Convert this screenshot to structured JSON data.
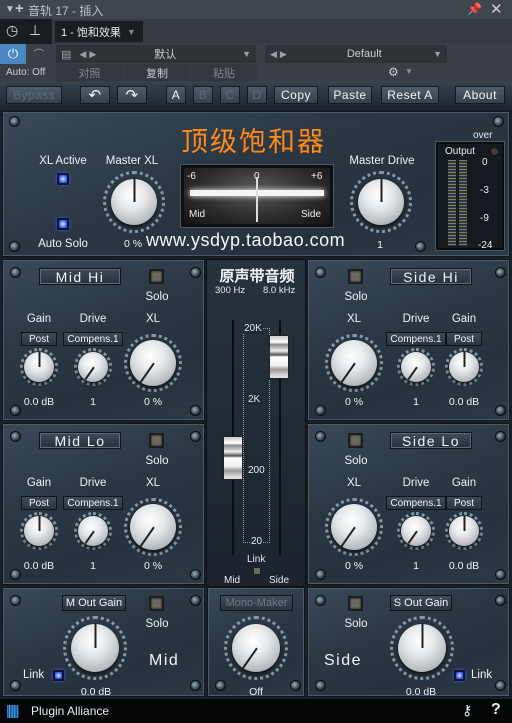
{
  "host": {
    "title": "音轨 17 - 插入",
    "preset_slot": "1 - 饱和效果",
    "auto_label": "Auto: Off",
    "preset_name_left": "默认",
    "preset_name_right": "Default",
    "compare_label": "对照",
    "copy_label": "复制",
    "paste_label": "粘贴"
  },
  "toolbar": {
    "bypass": "Bypass",
    "undo_icon": "undo-icon",
    "redo_icon": "redo-icon",
    "slots": [
      "A",
      "B",
      "C",
      "D"
    ],
    "copy": "Copy",
    "paste": "Paste",
    "reset": "Reset A",
    "about": "About"
  },
  "master": {
    "title": "顶级饱和器",
    "xl_active_label": "XL Active",
    "auto_solo_label": "Auto Solo",
    "master_xl_label": "Master XL",
    "master_xl_value": "0 %",
    "master_drive_label": "Master Drive",
    "master_drive_value": "1",
    "watermark": "www.ysdyp.taobao.com",
    "meter": {
      "left": "-6",
      "center": "0",
      "right": "+6",
      "mid": "Mid",
      "side": "Side"
    },
    "output": {
      "over": "over",
      "label": "Output",
      "scale": [
        "0",
        "-3",
        "-9",
        "-24"
      ]
    }
  },
  "bands": {
    "mid_hi": {
      "title": "Mid Hi",
      "solo": "Solo",
      "gain": "Gain",
      "drive": "Drive",
      "xl": "XL",
      "gain_mode": "Post",
      "drive_mode": "Compens.1",
      "gain_value": "0.0 dB",
      "drive_value": "1",
      "xl_value": "0 %"
    },
    "mid_lo": {
      "title": "Mid Lo",
      "solo": "Solo",
      "gain": "Gain",
      "drive": "Drive",
      "xl": "XL",
      "gain_mode": "Post",
      "drive_mode": "Compens.1",
      "gain_value": "0.0 dB",
      "drive_value": "1",
      "xl_value": "0 %"
    },
    "side_hi": {
      "title": "Side Hi",
      "solo": "Solo",
      "gain": "Gain",
      "drive": "Drive",
      "xl": "XL",
      "gain_mode": "Post",
      "drive_mode": "Compens.1",
      "gain_value": "0.0 dB",
      "drive_value": "1",
      "xl_value": "0 %"
    },
    "side_lo": {
      "title": "Side Lo",
      "solo": "Solo",
      "gain": "Gain",
      "drive": "Drive",
      "xl": "XL",
      "gain_mode": "Post",
      "drive_mode": "Compens.1",
      "gain_value": "0.0 dB",
      "drive_value": "1",
      "xl_value": "0 %"
    }
  },
  "crossover": {
    "title": "原声带音频",
    "mid_freq": "300 Hz",
    "side_freq": "8.0 kHz",
    "scale": [
      "20K",
      "2K",
      "200",
      "20"
    ],
    "link": "Link",
    "mid": "Mid",
    "side": "Side"
  },
  "output_section": {
    "m_out_gain": "M Out Gain",
    "m_value": "0.0 dB",
    "m_solo": "Solo",
    "m_word": "Mid",
    "m_link": "Link",
    "mono_maker": "Mono-Maker",
    "mono_value": "Off",
    "s_out_gain": "S Out Gain",
    "s_value": "0.0 dB",
    "s_solo": "Solo",
    "s_word": "Side",
    "s_link": "Link"
  },
  "footer": {
    "brand": "Plugin Alliance",
    "help": "?"
  },
  "colors": {
    "title_orange": "#ff8a1a",
    "active_blue": "#3a5cff"
  }
}
